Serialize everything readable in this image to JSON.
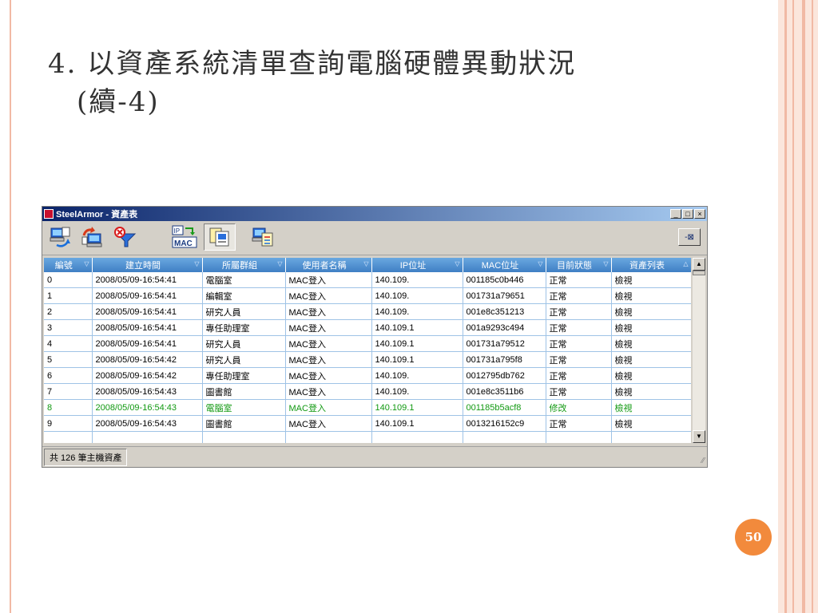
{
  "slide": {
    "title_line1": "4. 以資產系統清單查詢電腦硬體異動狀況",
    "title_line2": "(續-4)",
    "page_number": "50",
    "accent_color": "#f28a3c"
  },
  "window": {
    "title": "SteelArmor - 資產表",
    "controls": [
      "_",
      "□",
      "×"
    ],
    "toolbar_icons": [
      "computer-refresh-icon",
      "computer-import-icon",
      "filter-clear-icon",
      "ip-mac-icon",
      "asset-list-icon",
      "computer-report-icon"
    ],
    "pin_label": "-⊠"
  },
  "table": {
    "columns": [
      "編號",
      "建立時間",
      "所屬群組",
      "使用者名稱",
      "IP位址",
      "MAC位址",
      "目前狀態",
      "資產列表"
    ],
    "rows": [
      {
        "id": "0",
        "created": "2008/05/09-16:54:41",
        "group": "電腦室",
        "user": "MAC登入",
        "ip": "140.109.",
        "mac": "001185c0b446",
        "status": "正常",
        "action": "檢視"
      },
      {
        "id": "1",
        "created": "2008/05/09-16:54:41",
        "group": "編輯室",
        "user": "MAC登入",
        "ip": "140.109.",
        "mac": "001731a79651",
        "status": "正常",
        "action": "檢視"
      },
      {
        "id": "2",
        "created": "2008/05/09-16:54:41",
        "group": "研究人員",
        "user": "MAC登入",
        "ip": "140.109.",
        "mac": "001e8c351213",
        "status": "正常",
        "action": "檢視"
      },
      {
        "id": "3",
        "created": "2008/05/09-16:54:41",
        "group": "專任助理室",
        "user": "MAC登入",
        "ip": "140.109.1",
        "mac": "001a9293c494",
        "status": "正常",
        "action": "檢視"
      },
      {
        "id": "4",
        "created": "2008/05/09-16:54:41",
        "group": "研究人員",
        "user": "MAC登入",
        "ip": "140.109.1",
        "mac": "001731a79512",
        "status": "正常",
        "action": "檢視"
      },
      {
        "id": "5",
        "created": "2008/05/09-16:54:42",
        "group": "研究人員",
        "user": "MAC登入",
        "ip": "140.109.1",
        "mac": "001731a795f8",
        "status": "正常",
        "action": "檢視"
      },
      {
        "id": "6",
        "created": "2008/05/09-16:54:42",
        "group": "專任助理室",
        "user": "MAC登入",
        "ip": "140.109.",
        "mac": "0012795db762",
        "status": "正常",
        "action": "檢視"
      },
      {
        "id": "7",
        "created": "2008/05/09-16:54:43",
        "group": "圖書館",
        "user": "MAC登入",
        "ip": "140.109.",
        "mac": "001e8c3511b6",
        "status": "正常",
        "action": "檢視"
      },
      {
        "id": "8",
        "created": "2008/05/09-16:54:43",
        "group": "電腦室",
        "user": "MAC登入",
        "ip": "140.109.1",
        "mac": "001185b5acf8",
        "status": "修改",
        "action": "檢視",
        "changed": true
      },
      {
        "id": "9",
        "created": "2008/05/09-16:54:43",
        "group": "圖書館",
        "user": "MAC登入",
        "ip": "140.109.1",
        "mac": "0013216152c9",
        "status": "正常",
        "action": "檢視"
      }
    ],
    "changed_color": "#119911"
  },
  "status_bar": {
    "text": "共 126 筆主機資產"
  }
}
